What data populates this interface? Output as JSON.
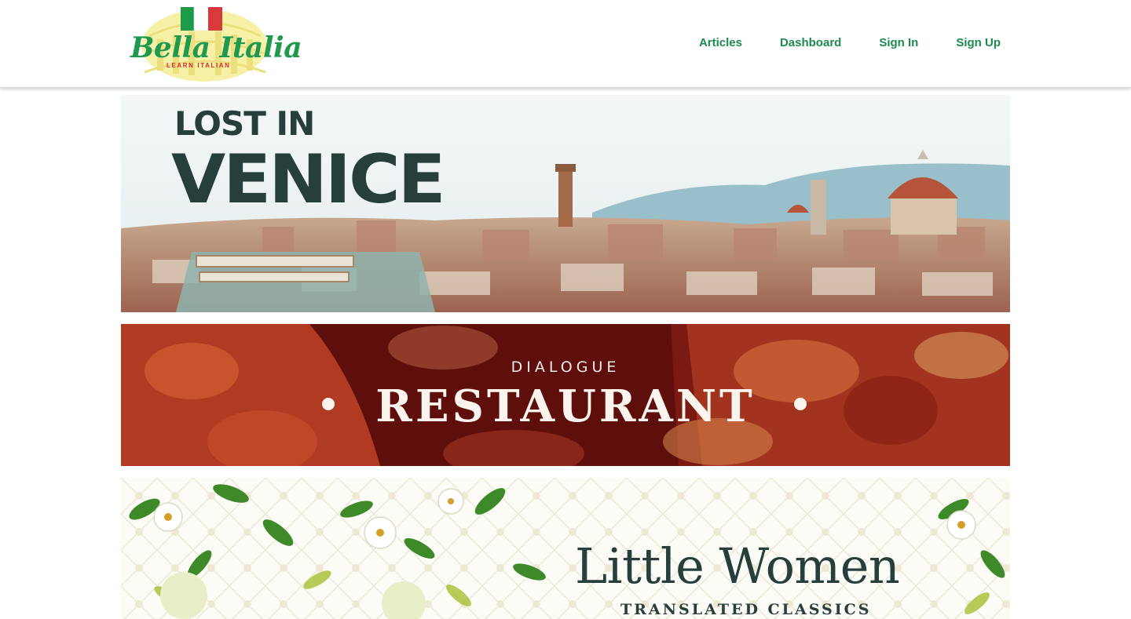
{
  "brand": {
    "name": "Bella Italia",
    "tagline": "LEARN ITALIAN",
    "colors": {
      "green": "#1f9a4c",
      "red": "#d42a2a",
      "nav": "#1c8a4f"
    }
  },
  "nav": {
    "articles": "Articles",
    "dashboard": "Dashboard",
    "sign_in": "Sign In",
    "sign_up": "Sign Up"
  },
  "banners": {
    "venice": {
      "line1": "LOST IN",
      "line2": "VENICE"
    },
    "restaurant": {
      "line1": "DIALOGUE",
      "line2": "RESTAURANT"
    },
    "little_women": {
      "title": "Little Women",
      "subtitle": "TRANSLATED CLASSICS"
    }
  }
}
